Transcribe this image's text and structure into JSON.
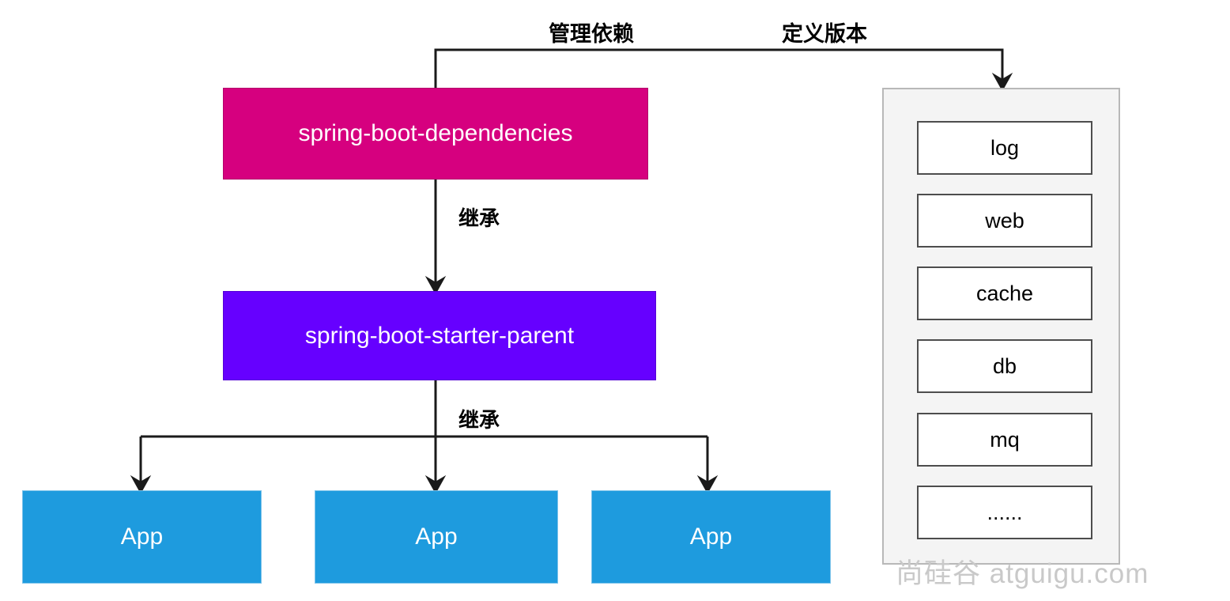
{
  "diagram": {
    "title": "Spring Boot dependency management diagram",
    "nodes": {
      "dependencies": "spring-boot-dependencies",
      "starter_parent": "spring-boot-starter-parent",
      "apps": [
        "App",
        "App",
        "App"
      ]
    },
    "edge_labels": {
      "manage_dependency": "管理依赖",
      "define_version": "定义版本",
      "inherit_1": "继承",
      "inherit_2": "继承"
    },
    "starter_panel": {
      "items": [
        "log",
        "web",
        "cache",
        "db",
        "mq",
        "......"
      ]
    },
    "watermark": "尚硅谷 atguigu.com",
    "colors": {
      "dependencies_box": "#D6007F",
      "starter_parent_box": "#6600FF",
      "app_box": "#1E9BDE",
      "panel_bg": "#F4F4F4",
      "panel_border": "#B8B8B8",
      "item_border": "#4D4D4D",
      "arrow": "#1A1A1A",
      "watermark": "#C9C9C9",
      "text_on_box": "#FFFFFF"
    }
  }
}
